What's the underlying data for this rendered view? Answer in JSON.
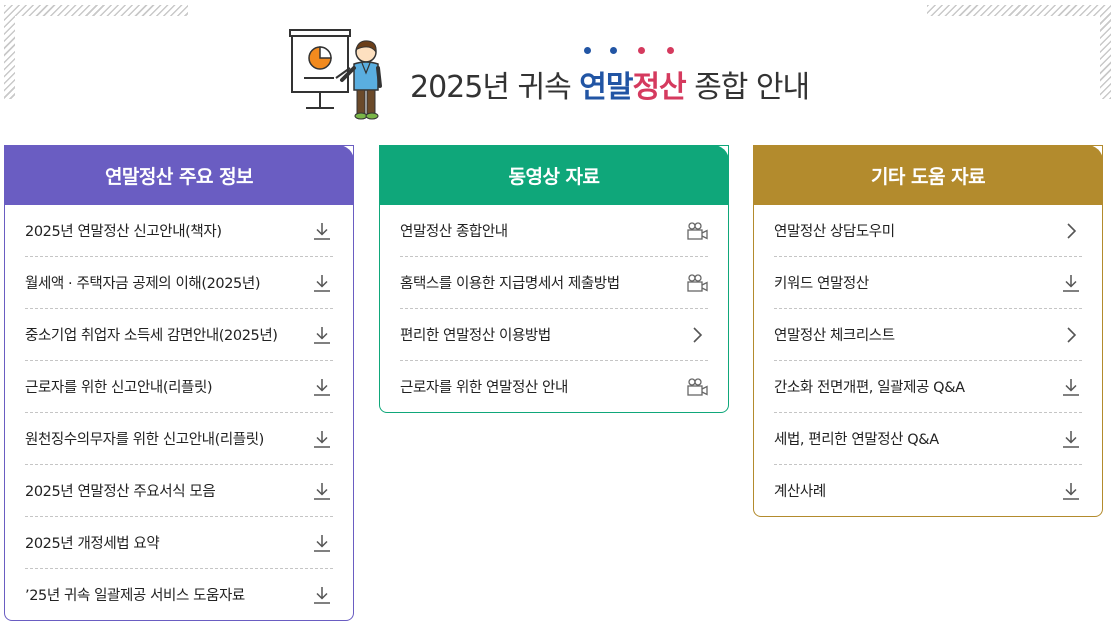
{
  "header": {
    "title_pre": "2025년 귀속",
    "title_hl1": "연말",
    "title_hl2": "정산",
    "title_post": "종합 안내",
    "dot_colors": [
      "#2255a4",
      "#2255a4",
      "#d53a5e",
      "#d53a5e"
    ]
  },
  "panels": [
    {
      "title": "연말정산 주요 정보",
      "color": "#6a5dc2",
      "items": [
        {
          "label": "2025년 연말정산 신고안내(책자)",
          "icon": "download-icon"
        },
        {
          "label": "월세액 · 주택자금 공제의 이해(2025년)",
          "icon": "download-icon"
        },
        {
          "label": "중소기업 취업자 소득세 감면안내(2025년)",
          "icon": "download-icon"
        },
        {
          "label": "근로자를 위한 신고안내(리플릿)",
          "icon": "download-icon"
        },
        {
          "label": "원천징수의무자를 위한 신고안내(리플릿)",
          "icon": "download-icon"
        },
        {
          "label": "2025년 연말정산 주요서식 모음",
          "icon": "download-icon"
        },
        {
          "label": "2025년 개정세법 요약",
          "icon": "download-icon"
        },
        {
          "label": "’25년 귀속 일괄제공 서비스 도움자료",
          "icon": "download-icon"
        }
      ]
    },
    {
      "title": "동영상 자료",
      "color": "#0fa77a",
      "items": [
        {
          "label": "연말정산 종합안내",
          "icon": "video-camera-icon"
        },
        {
          "label": "홈택스를 이용한 지급명세서 제출방법",
          "icon": "video-camera-icon"
        },
        {
          "label": "편리한 연말정산 이용방법",
          "icon": "chevron-right-icon"
        },
        {
          "label": "근로자를 위한 연말정산 안내",
          "icon": "video-camera-icon"
        }
      ]
    },
    {
      "title": "기타 도움 자료",
      "color": "#b38b2d",
      "items": [
        {
          "label": "연말정산 상담도우미",
          "icon": "chevron-right-icon"
        },
        {
          "label": "키워드 연말정산",
          "icon": "download-icon"
        },
        {
          "label": "연말정산 체크리스트",
          "icon": "chevron-right-icon"
        },
        {
          "label": "간소화 전면개편, 일괄제공 Q&A",
          "icon": "download-icon"
        },
        {
          "label": "세법, 편리한 연말정산 Q&A",
          "icon": "download-icon"
        },
        {
          "label": "계산사례",
          "icon": "download-icon"
        }
      ]
    }
  ]
}
